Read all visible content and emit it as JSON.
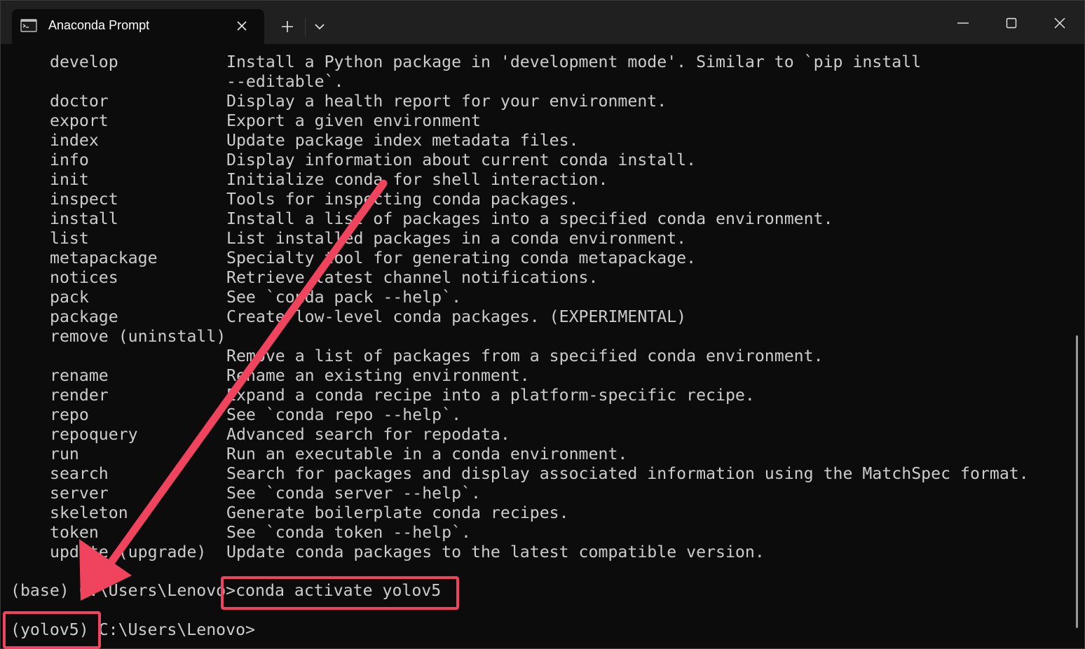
{
  "window": {
    "tab_title": "Anaconda Prompt",
    "icons": {
      "tab": "terminal-icon",
      "close_tab": "close-icon",
      "new_tab": "plus-icon",
      "dropdown": "chevron-down-icon",
      "minimize": "minimize-icon",
      "maximize": "maximize-icon",
      "close_window": "close-icon"
    }
  },
  "terminal": {
    "commands": [
      {
        "name": "develop",
        "desc": "Install a Python package in 'development mode'. Similar to `pip install"
      },
      {
        "name": "",
        "desc": "--editable`."
      },
      {
        "name": "doctor",
        "desc": "Display a health report for your environment."
      },
      {
        "name": "export",
        "desc": "Export a given environment"
      },
      {
        "name": "index",
        "desc": "Update package index metadata files."
      },
      {
        "name": "info",
        "desc": "Display information about current conda install."
      },
      {
        "name": "init",
        "desc": "Initialize conda for shell interaction."
      },
      {
        "name": "inspect",
        "desc": "Tools for inspecting conda packages."
      },
      {
        "name": "install",
        "desc": "Install a list of packages into a specified conda environment."
      },
      {
        "name": "list",
        "desc": "List installed packages in a conda environment."
      },
      {
        "name": "metapackage",
        "desc": "Specialty tool for generating conda metapackage."
      },
      {
        "name": "notices",
        "desc": "Retrieve latest channel notifications."
      },
      {
        "name": "pack",
        "desc": "See `conda pack --help`."
      },
      {
        "name": "package",
        "desc": "Create low-level conda packages. (EXPERIMENTAL)"
      },
      {
        "name": "remove (uninstall)",
        "desc": ""
      },
      {
        "name": "",
        "desc": "Remove a list of packages from a specified conda environment."
      },
      {
        "name": "rename",
        "desc": "Rename an existing environment."
      },
      {
        "name": "render",
        "desc": "Expand a conda recipe into a platform-specific recipe."
      },
      {
        "name": "repo",
        "desc": "See `conda repo --help`."
      },
      {
        "name": "repoquery",
        "desc": "Advanced search for repodata."
      },
      {
        "name": "run",
        "desc": "Run an executable in a conda environment."
      },
      {
        "name": "search",
        "desc": "Search for packages and display associated information using the MatchSpec format."
      },
      {
        "name": "server",
        "desc": "See `conda server --help`."
      },
      {
        "name": "skeleton",
        "desc": "Generate boilerplate conda recipes."
      },
      {
        "name": "token",
        "desc": "See `conda token --help`."
      },
      {
        "name": "update (upgrade)",
        "desc": "Update conda packages to the latest compatible version."
      }
    ],
    "prompt1": {
      "env": "(base)",
      "path": " C:\\Users\\Lenovo",
      "command": ">conda activate yolov5"
    },
    "prompt2": {
      "env": "(yolov5)",
      "path": " C:\\Users\\Lenovo>"
    }
  },
  "annotation": {
    "color": "#f0435e"
  }
}
